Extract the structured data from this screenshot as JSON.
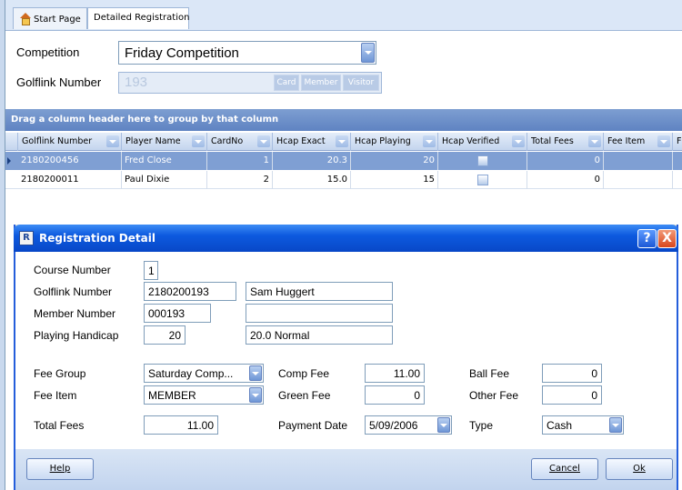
{
  "tabs": [
    {
      "label": "Start Page",
      "icon": "home-icon"
    },
    {
      "label": "Detailed Registration"
    }
  ],
  "top_form": {
    "competition_label": "Competition",
    "competition_value": "Friday Competition",
    "golflink_label": "Golflink Number",
    "golflink_value": "193",
    "buttons": [
      "Card",
      "Member",
      "Visitor"
    ]
  },
  "grid": {
    "group_hint": "Drag a column header here to group by that column",
    "columns": [
      "Golflink Number",
      "Player Name",
      "CardNo",
      "Hcap Exact",
      "Hcap Playing",
      "Hcap Verified",
      "Total Fees",
      "Fee Item",
      "F"
    ],
    "rows": [
      {
        "golflink": "2180200456",
        "name": "Fred Close",
        "card": "1",
        "exact": "20.3",
        "playing": "20",
        "fees": "0",
        "selected": true
      },
      {
        "golflink": "2180200011",
        "name": "Paul Dixie",
        "card": "2",
        "exact": "15.0",
        "playing": "15",
        "fees": "0",
        "selected": false
      }
    ]
  },
  "dialog": {
    "title": "Registration Detail",
    "help_glyph": "?",
    "close_glyph": "X",
    "course_number_label": "Course Number",
    "course_number": "1",
    "golflink_label": "Golflink Number",
    "golflink": "2180200193",
    "player_name": "Sam Huggert",
    "member_number_label": "Member Number",
    "member_number": "000193",
    "playing_handicap_label": "Playing Handicap",
    "playing_handicap": "20",
    "handicap_desc": "20.0 Normal",
    "fee_group_label": "Fee Group",
    "fee_group": "Saturday Comp...",
    "fee_item_label": "Fee Item",
    "fee_item": "MEMBER",
    "total_fees_label": "Total Fees",
    "total_fees": "11.00",
    "comp_fee_label": "Comp Fee",
    "comp_fee": "11.00",
    "green_fee_label": "Green Fee",
    "green_fee": "0",
    "payment_date_label": "Payment Date",
    "payment_date": "5/09/2006",
    "ball_fee_label": "Ball Fee",
    "ball_fee": "0",
    "other_fee_label": "Other Fee",
    "other_fee": "0",
    "type_label": "Type",
    "type": "Cash",
    "help_button": "Help",
    "cancel_button": "Cancel",
    "ok_button": "Ok"
  },
  "colors": {
    "title_bar": "#0d5adf",
    "selected_row": "#7f9fd3",
    "group_bar": "#6a8cc7"
  }
}
